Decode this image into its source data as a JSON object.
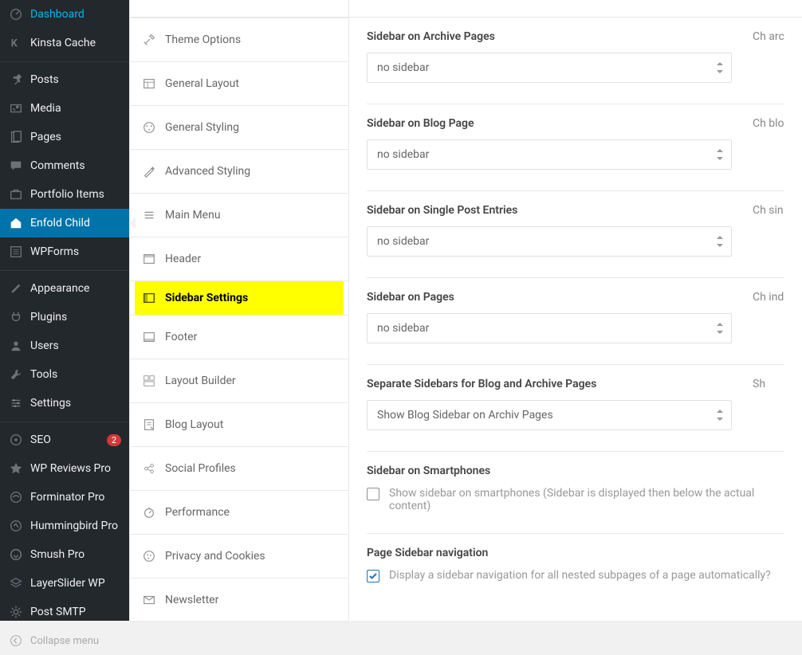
{
  "wp_menu": [
    {
      "icon": "dashboard",
      "label": "Dashboard"
    },
    {
      "icon": "kinsta",
      "label": "Kinsta Cache"
    },
    {
      "sep": true
    },
    {
      "icon": "pin",
      "label": "Posts"
    },
    {
      "icon": "media",
      "label": "Media"
    },
    {
      "icon": "pages",
      "label": "Pages"
    },
    {
      "icon": "comments",
      "label": "Comments"
    },
    {
      "icon": "portfolio",
      "label": "Portfolio Items"
    },
    {
      "icon": "home",
      "label": "Enfold Child",
      "active": true
    },
    {
      "icon": "wpforms",
      "label": "WPForms"
    },
    {
      "sep": true
    },
    {
      "icon": "brush",
      "label": "Appearance"
    },
    {
      "icon": "plug",
      "label": "Plugins"
    },
    {
      "icon": "user",
      "label": "Users"
    },
    {
      "icon": "wrench",
      "label": "Tools"
    },
    {
      "icon": "sliders",
      "label": "Settings"
    },
    {
      "sep": true
    },
    {
      "icon": "seo",
      "label": "SEO",
      "badge": "2"
    },
    {
      "icon": "star",
      "label": "WP Reviews Pro"
    },
    {
      "icon": "forminator",
      "label": "Forminator Pro"
    },
    {
      "icon": "hummingbird",
      "label": "Hummingbird Pro"
    },
    {
      "icon": "smush",
      "label": "Smush Pro"
    },
    {
      "icon": "layers",
      "label": "LayerSlider WP"
    },
    {
      "icon": "gear",
      "label": "Post SMTP"
    }
  ],
  "collapse_label": "Collapse menu",
  "theme_nav": [
    {
      "icon": "tools",
      "label": "Theme Options"
    },
    {
      "icon": "layout",
      "label": "General Layout"
    },
    {
      "icon": "styling",
      "label": "General Styling"
    },
    {
      "icon": "wand",
      "label": "Advanced Styling"
    },
    {
      "icon": "menu",
      "label": "Main Menu"
    },
    {
      "icon": "header",
      "label": "Header"
    },
    {
      "icon": "sidebar",
      "label": "Sidebar Settings",
      "highlight": true
    },
    {
      "icon": "footer",
      "label": "Footer"
    },
    {
      "icon": "builder",
      "label": "Layout Builder"
    },
    {
      "icon": "blog",
      "label": "Blog Layout"
    },
    {
      "icon": "social",
      "label": "Social Profiles"
    },
    {
      "icon": "perf",
      "label": "Performance"
    },
    {
      "icon": "cookie",
      "label": "Privacy and Cookies"
    },
    {
      "icon": "news",
      "label": "Newsletter"
    }
  ],
  "options": {
    "archive": {
      "label": "Sidebar on Archive Pages",
      "value": "no sidebar",
      "hint": "Ch arc"
    },
    "blog": {
      "label": "Sidebar on Blog Page",
      "value": "no sidebar",
      "hint": "Ch blo"
    },
    "single": {
      "label": "Sidebar on Single Post Entries",
      "value": "no sidebar",
      "hint": "Ch sin"
    },
    "pages": {
      "label": "Sidebar on Pages",
      "value": "no sidebar",
      "hint": "Ch ind"
    },
    "separate": {
      "label": "Separate Sidebars for Blog and Archive Pages",
      "value": "Show Blog Sidebar on Archiv Pages",
      "hint": "Sh"
    },
    "smartphones": {
      "label": "Sidebar on Smartphones",
      "check_label": "Show sidebar on smartphones (Sidebar is displayed then below the actual content)",
      "checked": false
    },
    "pagenav": {
      "label": "Page Sidebar navigation",
      "check_label": "Display a sidebar navigation for all nested subpages of a page automatically?",
      "checked": true
    }
  }
}
